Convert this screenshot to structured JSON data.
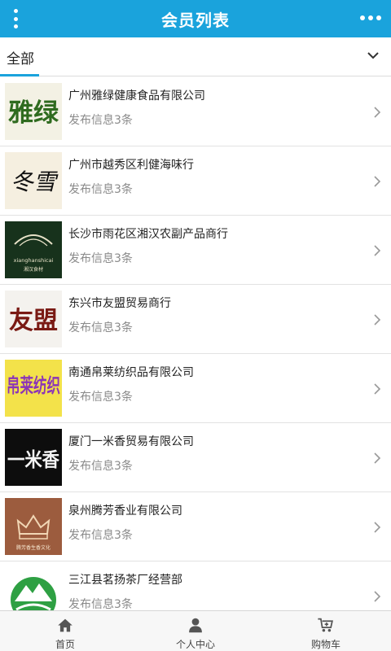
{
  "header": {
    "title": "会员列表",
    "menu_icon": "vertical-dots-icon",
    "more_icon": "horizontal-dots-icon",
    "accent": "#1aa3dc"
  },
  "filter": {
    "label": "全部",
    "chevron_icon": "chevron-down-icon"
  },
  "members": [
    {
      "name": "广州雅绿健康食品有限公司",
      "info": "发布信息3条",
      "logo_text": "雅绿"
    },
    {
      "name": "广州市越秀区利健海味行",
      "info": "发布信息3条",
      "logo_text": "冬雪"
    },
    {
      "name": "长沙市雨花区湘汉农副产品商行",
      "info": "发布信息3条",
      "logo_text": "xianghanshicai",
      "logo_subtext": "湘汉食材"
    },
    {
      "name": "东兴市友盟贸易商行",
      "info": "发布信息3条",
      "logo_text": "友盟"
    },
    {
      "name": "南通帛莱纺织品有限公司",
      "info": "发布信息3条",
      "logo_text": "帛莱纺织"
    },
    {
      "name": "厦门一米香贸易有限公司",
      "info": "发布信息3条",
      "logo_text": "一米香"
    },
    {
      "name": "泉州腾芳香业有限公司",
      "info": "发布信息3条",
      "logo_text": "腾芳香生香文化"
    },
    {
      "name": "三江县茗扬茶厂经营部",
      "info": "发布信息3条",
      "logo_text": ""
    }
  ],
  "bottom_nav": [
    {
      "label": "首页",
      "icon": "home-icon"
    },
    {
      "label": "个人中心",
      "icon": "user-icon"
    },
    {
      "label": "购物车",
      "icon": "cart-icon"
    }
  ]
}
